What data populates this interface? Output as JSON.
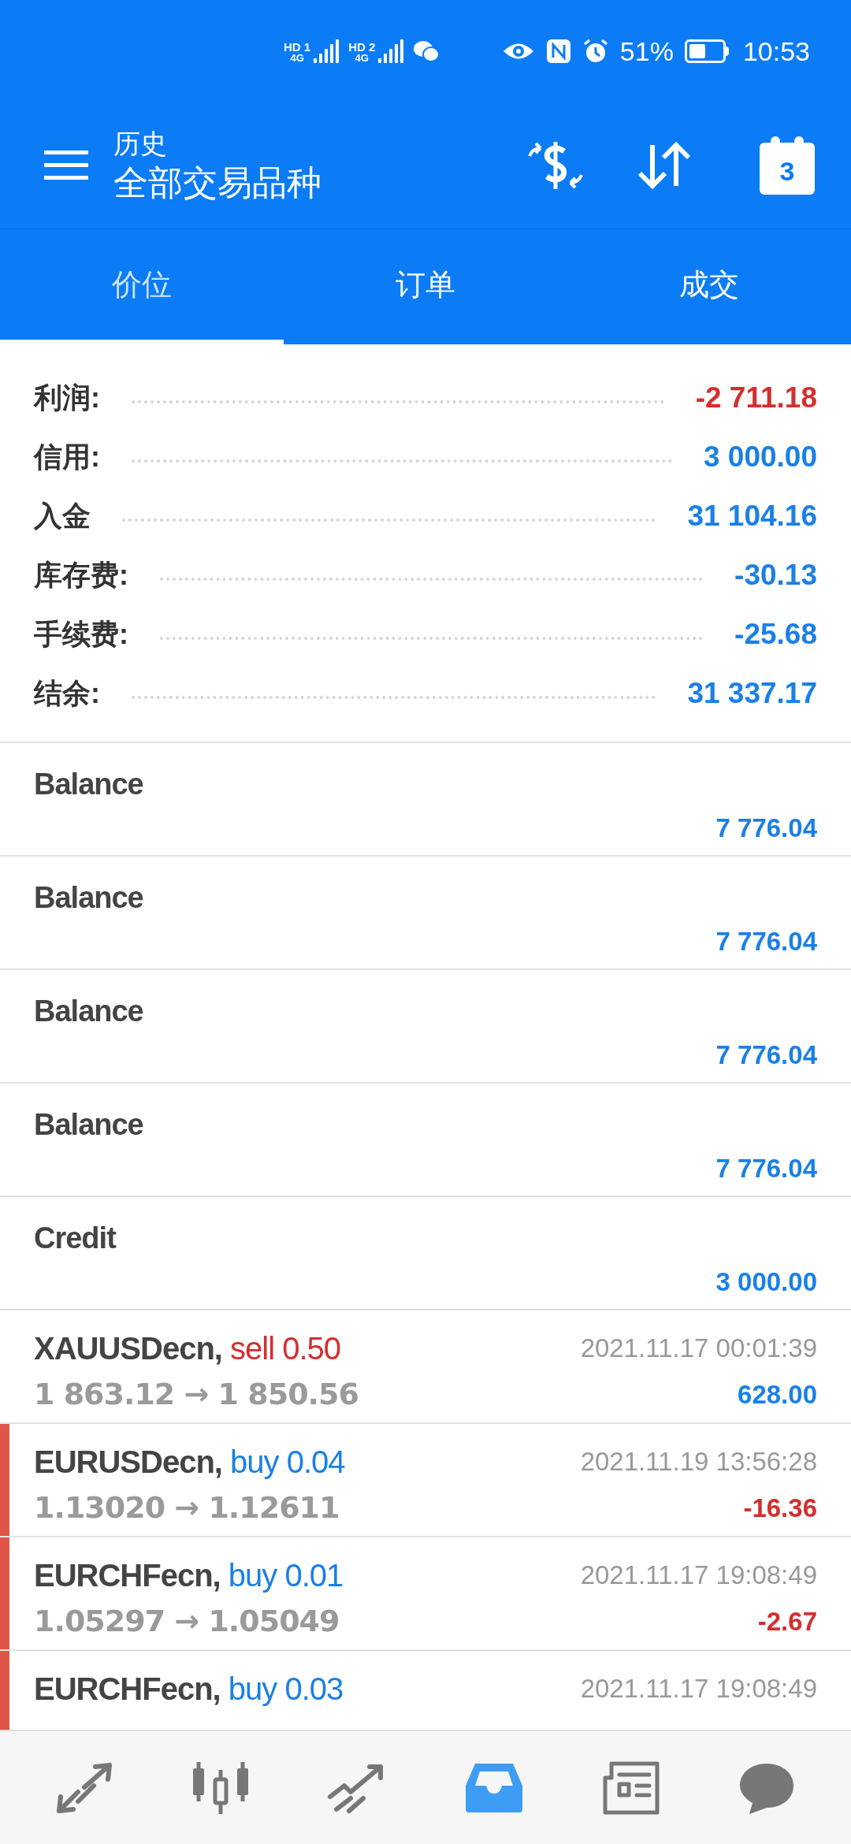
{
  "status_bar": {
    "sims": [
      {
        "hd": "HD",
        "slot": "1",
        "network": "4G"
      },
      {
        "hd": "HD",
        "slot": "2",
        "network": "4G"
      }
    ],
    "battery_text": "51%",
    "time": "10:53"
  },
  "header": {
    "subtitle": "历史",
    "title": "全部交易品种",
    "calendar_day": "3"
  },
  "tabs": [
    {
      "label": "价位",
      "selected": true
    },
    {
      "label": "订单",
      "selected": false
    },
    {
      "label": "成交",
      "selected": false
    }
  ],
  "summary": [
    {
      "label": "利润:",
      "value": "-2 711.18",
      "negative": true
    },
    {
      "label": "信用:",
      "value": "3 000.00",
      "negative": false
    },
    {
      "label": "入金",
      "value": "31 104.16",
      "negative": false
    },
    {
      "label": "库存费:",
      "value": "-30.13",
      "negative": false
    },
    {
      "label": "手续费:",
      "value": "-25.68",
      "negative": false
    },
    {
      "label": "结余:",
      "value": "31 337.17",
      "negative": false
    }
  ],
  "operations": [
    {
      "title": "Balance",
      "amount": "7 776.04"
    },
    {
      "title": "Balance",
      "amount": "7 776.04"
    },
    {
      "title": "Balance",
      "amount": "7 776.04"
    },
    {
      "title": "Balance",
      "amount": "7 776.04"
    },
    {
      "title": "Credit",
      "amount": "3 000.00"
    }
  ],
  "deals": [
    {
      "symbol": "XAUUSDecn,",
      "side": "sell",
      "volume": "0.50",
      "time": "2021.11.17 00:01:39",
      "prices": "1 863.12 → 1 850.56",
      "profit": "628.00",
      "marked": false
    },
    {
      "symbol": "EURUSDecn,",
      "side": "buy",
      "volume": "0.04",
      "time": "2021.11.19 13:56:28",
      "prices": "1.13020 → 1.12611",
      "profit": "-16.36",
      "marked": true
    },
    {
      "symbol": "EURCHFecn,",
      "side": "buy",
      "volume": "0.01",
      "time": "2021.11.17 19:08:49",
      "prices": "1.05297 → 1.05049",
      "profit": "-2.67",
      "marked": true
    },
    {
      "symbol": "EURCHFecn,",
      "side": "buy",
      "volume": "0.03",
      "time": "2021.11.17 19:08:49",
      "marked": true
    }
  ],
  "bottom_nav": [
    {
      "kind": "quotes",
      "selected": false
    },
    {
      "kind": "chart",
      "selected": false
    },
    {
      "kind": "trade",
      "selected": false
    },
    {
      "kind": "history",
      "selected": true
    },
    {
      "kind": "news",
      "selected": false
    },
    {
      "kind": "chat",
      "selected": false
    }
  ]
}
